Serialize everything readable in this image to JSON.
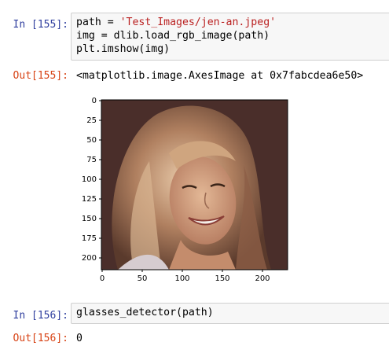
{
  "cells": [
    {
      "in_prompt": "In [155]:",
      "code_lines": [
        {
          "pre": "path = ",
          "str": "'Test_Images/jen-an.jpeg'"
        },
        {
          "pre": "img = dlib.load_rgb_image(path)",
          "str": ""
        },
        {
          "pre": "plt.imshow(img)",
          "str": ""
        }
      ],
      "out_prompt": "Out[155]:",
      "output_text": "<matplotlib.image.AxesImage at 0x7fabcdea6e50>",
      "plot": {
        "image_content": "photo-portrait-smiling-woman-long-blonde-hair",
        "x_ticks": [
          "0",
          "50",
          "100",
          "150",
          "200"
        ],
        "y_ticks": [
          "0",
          "25",
          "50",
          "75",
          "100",
          "125",
          "150",
          "175",
          "200"
        ]
      }
    },
    {
      "in_prompt": "In [156]:",
      "code_lines": [
        {
          "pre": "glasses_detector(path)",
          "str": ""
        }
      ],
      "out_prompt": "Out[156]:",
      "output_text": "0"
    }
  ],
  "colors": {
    "in_prompt": "#303f9f",
    "out_prompt": "#d84315",
    "string": "#ba2121",
    "code_bg": "#f7f7f7"
  }
}
